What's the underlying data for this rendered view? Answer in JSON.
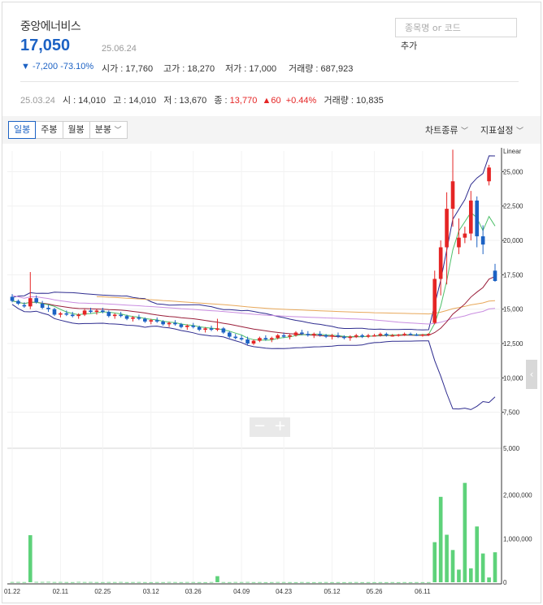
{
  "stock": {
    "name": "중앙에너비스",
    "price": "17,050",
    "date": "25.06.24",
    "change": "▼ -7,200  -73.10%",
    "open_label": "시가 :",
    "open": "17,760",
    "high_label": "고가 :",
    "high": "18,270",
    "low_label": "저가 :",
    "low": "17,000",
    "volume_label": "거래량 :",
    "volume": "687,923"
  },
  "search": {
    "placeholder": "종목명 or 코드",
    "add_label": "추가"
  },
  "prev_day": {
    "date": "25.03.24",
    "open_label": "시 :",
    "open": "14,010",
    "high_label": "고 :",
    "high": "14,010",
    "low_label": "저 :",
    "low": "13,670",
    "close_label": "종 :",
    "close": "13,770",
    "change": "▲60",
    "change_pct": "+0.44%",
    "volume_label": "거래량 :",
    "volume": "10,835"
  },
  "toolbar": {
    "tabs": [
      "일봉",
      "주봉",
      "월봉",
      "분봉"
    ],
    "active_tab": "일봉",
    "chart_type_label": "차트종류",
    "indicator_label": "지표설정"
  },
  "colors": {
    "up": "#e52525",
    "down": "#1c62c4",
    "accent": "#1c62c4",
    "volume": "#5ed27a",
    "ma_short": "#4fc06a",
    "ma_mid": "#9a1e3a",
    "ma_long": "#e8a85a",
    "ma_longest": "#c98de0",
    "bollinger": "#2e2c8f"
  },
  "chart_data": {
    "type": "candlestick",
    "price_axis": {
      "label": "Linear",
      "ticks": [
        25000,
        22500,
        20000,
        17500,
        15000,
        12500,
        10000,
        7500
      ],
      "range": [
        5000,
        26500
      ]
    },
    "volume_axis": {
      "ticks": [
        2000000,
        1000000,
        0
      ],
      "top_label": "5,000",
      "range": [
        0,
        3000000
      ]
    },
    "x_ticks": [
      "01.22",
      "02.11",
      "02.25",
      "03.12",
      "03.26",
      "04.09",
      "04.23",
      "05.12",
      "05.26",
      "06.11"
    ],
    "ohlc_sample": [
      [
        15900,
        16100,
        15500,
        15600
      ],
      [
        15600,
        15700,
        15300,
        15400
      ],
      [
        15300,
        15500,
        15100,
        15200
      ],
      [
        15200,
        17700,
        15000,
        15800
      ],
      [
        15800,
        16000,
        15400,
        15500
      ],
      [
        15400,
        15600,
        15000,
        15100
      ],
      [
        15100,
        15300,
        14800,
        15000
      ],
      [
        15000,
        15100,
        14500,
        14600
      ],
      [
        14600,
        14800,
        14400,
        14700
      ],
      [
        14700,
        14900,
        14500,
        14600
      ],
      [
        14600,
        14800,
        14400,
        14500
      ],
      [
        14500,
        14700,
        14300,
        14600
      ],
      [
        14600,
        15000,
        14500,
        14900
      ],
      [
        14900,
        15100,
        14700,
        14800
      ],
      [
        14800,
        15000,
        14600,
        14900
      ],
      [
        14900,
        15100,
        14700,
        14800
      ],
      [
        14800,
        14900,
        14400,
        14500
      ],
      [
        14500,
        14700,
        14300,
        14600
      ],
      [
        14600,
        14800,
        14400,
        14500
      ],
      [
        14500,
        14600,
        14200,
        14300
      ],
      [
        14300,
        14500,
        14100,
        14400
      ],
      [
        14400,
        14600,
        14200,
        14300
      ],
      [
        14300,
        14400,
        14000,
        14100
      ],
      [
        14100,
        14300,
        13900,
        14200
      ],
      [
        14200,
        14400,
        14000,
        14100
      ],
      [
        14100,
        14200,
        13800,
        13900
      ],
      [
        13900,
        14100,
        13700,
        14000
      ],
      [
        14000,
        14200,
        13800,
        13900
      ],
      [
        13900,
        14000,
        13600,
        13700
      ],
      [
        13700,
        13900,
        13500,
        13800
      ],
      [
        13800,
        14000,
        13600,
        13700
      ],
      [
        13700,
        13800,
        13400,
        13500
      ],
      [
        13500,
        13700,
        13300,
        13600
      ],
      [
        13600,
        13800,
        13400,
        13500
      ],
      [
        13500,
        14300,
        13400,
        13600
      ],
      [
        13600,
        13700,
        13200,
        13300
      ],
      [
        13300,
        13400,
        12900,
        13000
      ],
      [
        13000,
        13200,
        12800,
        12900
      ],
      [
        12900,
        13100,
        12700,
        12800
      ],
      [
        12800,
        13000,
        12400,
        12500
      ],
      [
        12500,
        12800,
        12400,
        12700
      ],
      [
        12700,
        13000,
        12600,
        12900
      ],
      [
        12900,
        13100,
        12700,
        12800
      ],
      [
        12800,
        13000,
        12600,
        12900
      ],
      [
        12900,
        13200,
        12800,
        13100
      ],
      [
        13100,
        13300,
        12900,
        13000
      ],
      [
        13000,
        13200,
        12800,
        13100
      ],
      [
        13100,
        13400,
        13000,
        13300
      ],
      [
        13300,
        13500,
        13100,
        13200
      ],
      [
        13200,
        13400,
        13000,
        13100
      ],
      [
        13100,
        13300,
        12900,
        13200
      ],
      [
        13200,
        13400,
        13000,
        13100
      ],
      [
        13100,
        13200,
        12900,
        13000
      ],
      [
        13000,
        13200,
        12800,
        13100
      ],
      [
        13100,
        13300,
        12900,
        13000
      ],
      [
        13000,
        13100,
        12800,
        12900
      ],
      [
        12900,
        13100,
        12700,
        13000
      ],
      [
        13000,
        13200,
        12900,
        13100
      ],
      [
        13100,
        13200,
        12900,
        13000
      ],
      [
        13000,
        13200,
        12900,
        13100
      ],
      [
        13100,
        13200,
        13000,
        13100
      ],
      [
        13100,
        13300,
        13000,
        13200
      ],
      [
        13200,
        13300,
        13000,
        13100
      ],
      [
        13100,
        13200,
        13000,
        13100
      ],
      [
        13100,
        13200,
        13000,
        13150
      ],
      [
        13150,
        13300,
        13050,
        13200
      ],
      [
        13200,
        13300,
        13100,
        13150
      ],
      [
        13150,
        13250,
        13050,
        13100
      ],
      [
        13100,
        13200,
        13000,
        13150
      ],
      [
        13150,
        13250,
        13050,
        13200
      ],
      [
        14000,
        17800,
        13900,
        17200
      ],
      [
        17200,
        20000,
        16000,
        19500
      ],
      [
        19500,
        23500,
        16800,
        22300
      ],
      [
        22300,
        26600,
        21000,
        24300
      ],
      [
        19500,
        21600,
        19000,
        20200
      ],
      [
        20200,
        21000,
        19800,
        20500
      ],
      [
        20500,
        23600,
        20000,
        22900
      ],
      [
        22900,
        23200,
        19500,
        20300
      ],
      [
        20300,
        21100,
        19000,
        19700
      ],
      [
        24300,
        25500,
        24000,
        25300
      ],
      [
        17800,
        18300,
        17000,
        17050
      ]
    ],
    "volume_sample": [
      5000,
      6000,
      4000,
      1080000,
      8000,
      7000,
      9000,
      5000,
      6000,
      4000,
      3000,
      8000,
      5000,
      6000,
      4000,
      3000,
      5000,
      4000,
      6000,
      3000,
      4000,
      5000,
      3000,
      2000,
      4000,
      3000,
      6000,
      4000,
      3000,
      5000,
      4000,
      3000,
      2000,
      5000,
      140000,
      4000,
      3000,
      5000,
      4000,
      6000,
      3000,
      4000,
      2000,
      3000,
      5000,
      4000,
      3000,
      2000,
      4000,
      3000,
      2000,
      3000,
      4000,
      2000,
      3000,
      2000,
      3000,
      4000,
      2000,
      3000,
      2000,
      3000,
      2000,
      3000,
      2000,
      3000,
      2000,
      3000,
      2000,
      3000,
      920000,
      1960000,
      1090000,
      740000,
      290000,
      2280000,
      320000,
      1280000,
      660000,
      110000,
      687923
    ]
  }
}
